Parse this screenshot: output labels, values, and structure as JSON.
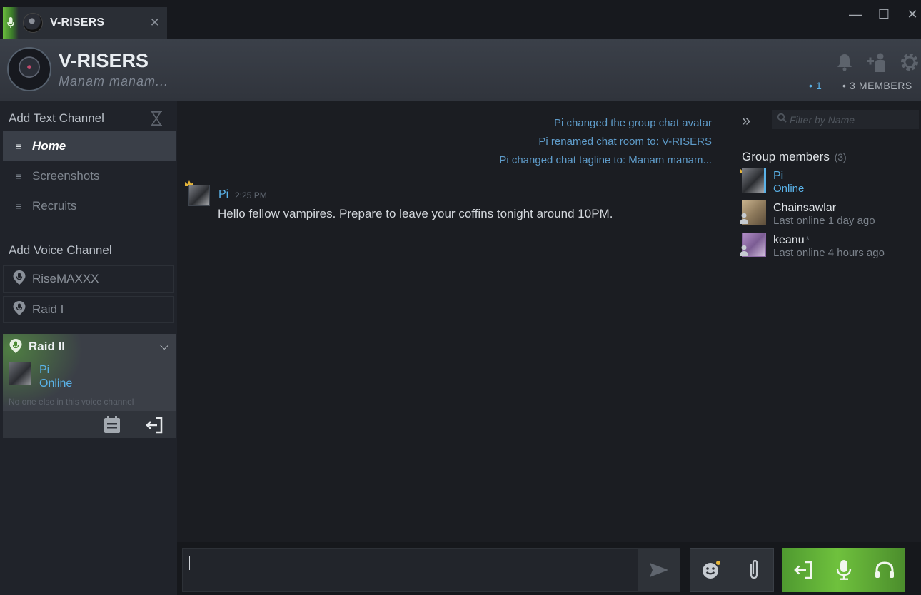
{
  "titlebar": {
    "tab_title": "V-RISERS",
    "tab_close": "✕",
    "minimize": "—",
    "maximize": "☐",
    "close": "✕"
  },
  "header": {
    "group_name": "V-RISERS",
    "tagline": "Manam manam...",
    "online_count": "• 1",
    "members_count": "• 3 MEMBERS",
    "icons": [
      "bell-icon",
      "add-friend-icon",
      "gear-icon"
    ]
  },
  "sidebar": {
    "text_section": "Add Text Channel",
    "text_channels": [
      {
        "label": "Home",
        "active": true
      },
      {
        "label": "Screenshots",
        "active": false
      },
      {
        "label": "Recruits",
        "active": false
      }
    ],
    "voice_section": "Add Voice Channel",
    "voice_channels": [
      {
        "label": "RiseMAXXX"
      },
      {
        "label": "Raid I"
      }
    ],
    "active_voice": {
      "label": "Raid II",
      "user_name": "Pi",
      "user_status": "Online",
      "empty_note": "No one else in this voice channel"
    }
  },
  "chat": {
    "system_messages": [
      "Pi changed the group chat avatar",
      "Pi renamed chat room to: V-RISERS",
      "Pi changed chat tagline to: Manam manam..."
    ],
    "message": {
      "author": "Pi",
      "time": "2:25 PM",
      "text": "Hello fellow vampires. Prepare to leave your coffins tonight around 10PM."
    }
  },
  "members_panel": {
    "filter_placeholder": "Filter by Name",
    "title": "Group members",
    "count": "(3)",
    "members": [
      {
        "name": "Pi",
        "status": "Online"
      },
      {
        "name": "Chainsawlar",
        "status": "Last online 1 day ago"
      },
      {
        "name": "keanu",
        "badge": "*",
        "status": "Last online 4 hours ago"
      }
    ]
  },
  "composer": {
    "value": ""
  },
  "colors": {
    "accent_blue": "#5ab2e8",
    "voice_green": "#6fc13d",
    "system_blue": "#5f9cca",
    "crown_gold": "#e5b53a"
  }
}
